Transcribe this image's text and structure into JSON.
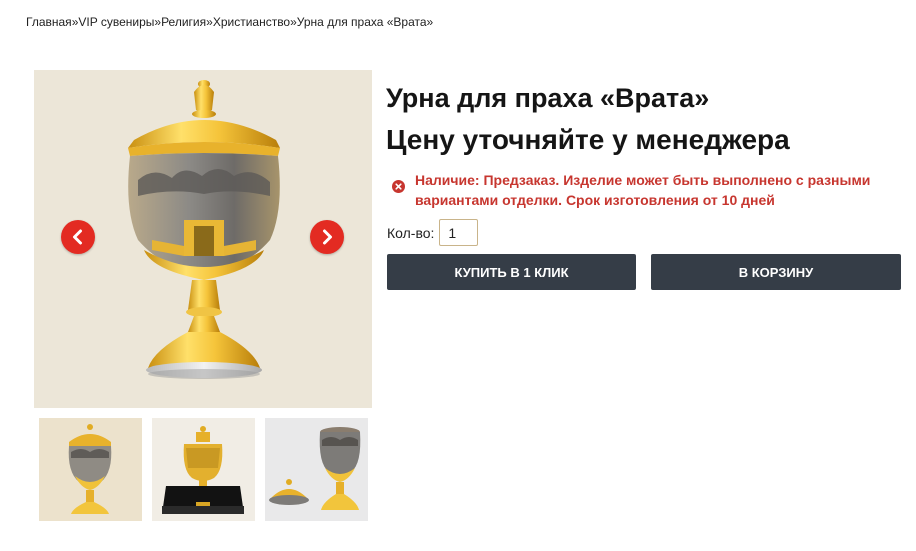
{
  "breadcrumb": {
    "items": [
      {
        "label": "Главная"
      },
      {
        "label": "VIP сувениры"
      },
      {
        "label": "Религия"
      },
      {
        "label": "Христианство"
      },
      {
        "label": "Урна для праха «Врата»"
      }
    ],
    "separator": "»"
  },
  "gallery": {
    "prev_icon": "chevron-left-icon",
    "next_icon": "chevron-right-icon",
    "accent_color": "#e32b22",
    "thumbnail_count": 3
  },
  "product": {
    "title": "Урна для праха «Врата»",
    "price_note": "Цену уточняйте у менеджера",
    "availability": "Наличие: Предзаказ. Изделие может быть выполнено с разными вариантами отделки. Срок изготовления от 10 дней",
    "availability_color": "#c7362f",
    "qty_label": "Кол-во:",
    "qty_value": "1"
  },
  "buttons": {
    "buy_one_click": "КУПИТЬ В 1 КЛИК",
    "add_to_cart": "В КОРЗИНУ",
    "color": "#353d47"
  }
}
